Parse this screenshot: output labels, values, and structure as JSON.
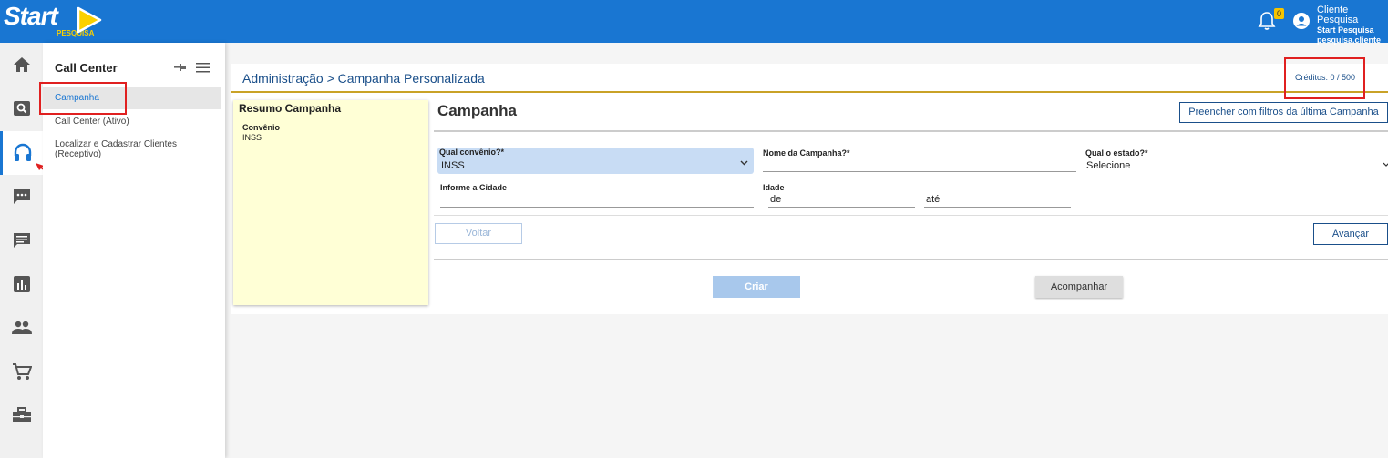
{
  "header": {
    "logo_text": "Start",
    "logo_sub": "PESQUISA",
    "notification_count": "0",
    "user_name": "Cliente Pesquisa",
    "user_company": "Start Pesquisa",
    "user_login": "pesquisa.cliente"
  },
  "iconbar": {
    "icons": [
      "home-icon",
      "search-icon",
      "headset-icon",
      "chat-bubble-icon",
      "message-icon",
      "bar-chart-icon",
      "people-icon",
      "cart-icon",
      "briefcase-icon"
    ],
    "active": "headset-icon"
  },
  "menu": {
    "title": "Call Center",
    "items": [
      {
        "label": "Campanha"
      },
      {
        "label": "Call Center (Ativo)"
      },
      {
        "label": "Localizar e Cadastrar Clientes"
      },
      {
        "label": "(Receptivo)"
      }
    ]
  },
  "main": {
    "breadcrumb": "Administração > Campanha Personalizada",
    "credits": "Créditos: 0 / 500",
    "summary": {
      "title": "Resumo Campanha",
      "label": "Convênio",
      "value": "INSS"
    },
    "form_title": "Campanha",
    "fill_button": "Preencher com filtros da última Campanha",
    "fields": {
      "convenio_label": "Qual convênio?*",
      "convenio_value": "INSS",
      "nome_label": "Nome da Campanha?*",
      "estado_label": "Qual o estado?*",
      "estado_value": "Selecione",
      "cidade_label": "Informe a Cidade",
      "idade_label": "Idade",
      "idade_de": "de",
      "idade_ate": "até"
    },
    "buttons": {
      "voltar": "Voltar",
      "avancar": "Avançar",
      "criar": "Criar",
      "acompanhar": "Acompanhar"
    }
  },
  "colors": {
    "header_bg": "#1976d2",
    "accent_gold": "#c9a227",
    "summary_bg": "#ffffd6",
    "highlight_red": "#e02020"
  }
}
